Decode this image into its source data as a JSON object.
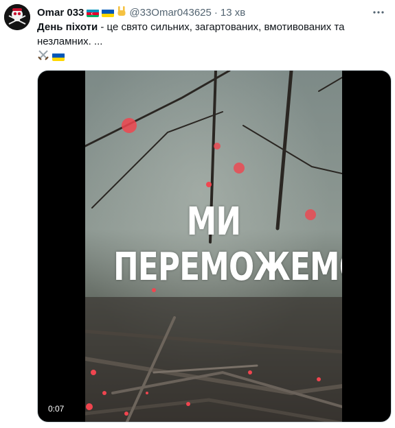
{
  "tweet": {
    "display_name": "Omar 033",
    "handle": "@33Omar043625",
    "separator": "·",
    "time": "13 хв",
    "text_bold": "День піхоти",
    "text_rest": " - це свято сильних, загартованих, вмотивованих та незламних. ...",
    "more_label": "⋯"
  },
  "media": {
    "overlay_line1": "МИ",
    "overlay_line2": "ПЕРЕМОЖЕМО",
    "duration": "0:07"
  },
  "icons": {
    "avatar": "pirate-skull-icon",
    "flag_az": "azerbaijan-flag-icon",
    "flag_ua": "ukraine-flag-icon",
    "rock_hand": "rock-hand-icon",
    "swords": "crossed-swords-icon",
    "more": "more-icon"
  },
  "colors": {
    "text": "#0f1419",
    "secondary": "#536471",
    "ua_blue": "#0057b7",
    "ua_yellow": "#ffd700",
    "az_blue": "#0092bc",
    "az_red": "#e4002b",
    "az_green": "#00af66"
  }
}
